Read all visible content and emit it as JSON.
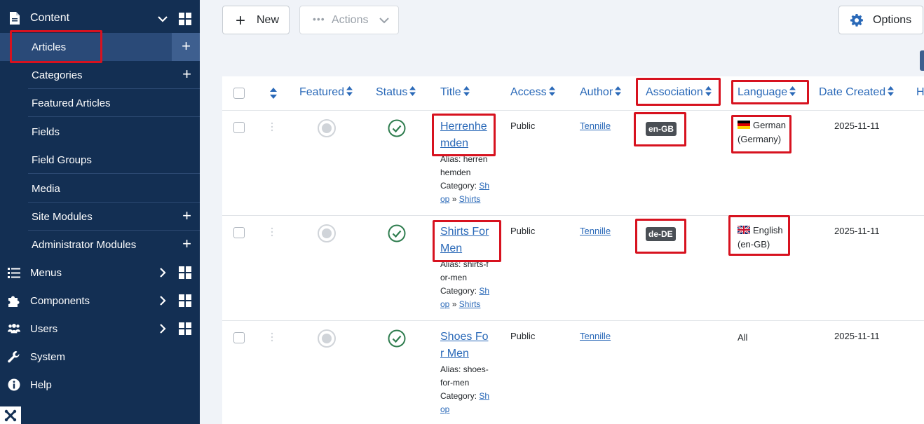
{
  "sidebar": {
    "content_label": "Content",
    "sub_items": [
      {
        "label": "Articles",
        "has_add": true,
        "active": true
      },
      {
        "label": "Categories",
        "has_add": true
      },
      {
        "label": "Featured Articles",
        "has_add": false
      },
      {
        "label": "Fields",
        "has_add": false
      },
      {
        "label": "Field Groups",
        "has_add": false
      },
      {
        "label": "Media",
        "has_add": false
      },
      {
        "label": "Site Modules",
        "has_add": true
      },
      {
        "label": "Administrator Modules",
        "has_add": true
      }
    ],
    "main_items": [
      {
        "label": "Menus",
        "icon": "list-icon"
      },
      {
        "label": "Components",
        "icon": "puzzle-icon"
      },
      {
        "label": "Users",
        "icon": "users-icon"
      },
      {
        "label": "System",
        "icon": "wrench-icon"
      },
      {
        "label": "Help",
        "icon": "info-icon"
      }
    ]
  },
  "toolbar": {
    "new_label": "New",
    "actions_label": "Actions",
    "options_label": "Options"
  },
  "table": {
    "headers": {
      "featured": "Featured",
      "status": "Status",
      "title": "Title",
      "access": "Access",
      "author": "Author",
      "association": "Association",
      "language": "Language",
      "date_created": "Date Created",
      "hits_partial": "H"
    },
    "rows": [
      {
        "title": "Herrenhemden",
        "alias_label": "Alias:",
        "alias": "herrenhemden",
        "category_label": "Category:",
        "category_parent": "Shop",
        "category_sep": "»",
        "category_child": "Shirts",
        "access": "Public",
        "author": "Tennille",
        "association": "en-GB",
        "language": "German (Germany)",
        "flag": "de",
        "date": "2025-11-11"
      },
      {
        "title": "Shirts For Men",
        "alias_label": "Alias:",
        "alias": "shirts-for-men",
        "category_label": "Category:",
        "category_parent": "Shop",
        "category_sep": "»",
        "category_child": "Shirts",
        "access": "Public",
        "author": "Tennille",
        "association": "de-DE",
        "language": "English (en-GB)",
        "flag": "gb",
        "date": "2025-11-11"
      },
      {
        "title": "Shoes For Men",
        "alias_label": "Alias:",
        "alias": "shoes-for-men",
        "category_label": "Category:",
        "category_parent": "Shop",
        "access": "Public",
        "author": "Tennille",
        "association": "",
        "language": "All",
        "flag": "",
        "date": "2025-11-11"
      }
    ]
  },
  "colors": {
    "sidebar_bg": "#132f53",
    "link": "#2a69b8",
    "highlight": "#d7121f",
    "status_ok": "#2f7d4f"
  }
}
